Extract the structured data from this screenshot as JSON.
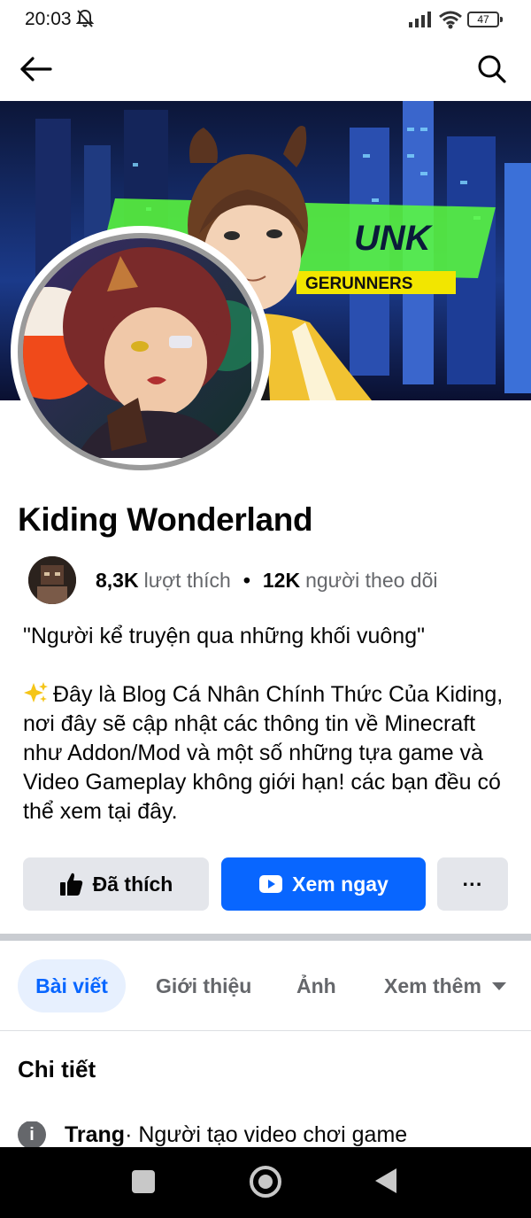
{
  "status_bar": {
    "time": "20:03",
    "battery": "47",
    "icons": [
      "bell-off-icon",
      "signal-icon",
      "wifi-icon",
      "battery-icon"
    ]
  },
  "nav": {
    "icons": [
      "back-arrow-icon",
      "search-icon"
    ]
  },
  "cover": {
    "visible_text": [
      "UNK",
      "GERUNNERS"
    ]
  },
  "page": {
    "name": "Kiding Wonderland",
    "likes_count": "8,3K",
    "likes_label": "lượt thích",
    "followers_count": "12K",
    "followers_label": "người theo dõi"
  },
  "bio": {
    "tagline": "\"Người kể truyện qua những khối vuông\"",
    "description": "Đây là Blog Cá Nhân Chính Thức Của Kiding, nơi đây sẽ cập nhật các thông tin về Minecraft như Addon/Mod và một số những tựa game và Video Gameplay không giới hạn! các bạn đều có thể xem tại đây."
  },
  "actions": {
    "liked_label": "Đã thích",
    "watch_label": "Xem ngay",
    "more_label": "···"
  },
  "tabs": [
    {
      "label": "Bài viết",
      "active": true
    },
    {
      "label": "Giới thiệu",
      "active": false
    },
    {
      "label": "Ảnh",
      "active": false
    },
    {
      "label": "Xem thêm",
      "active": false
    }
  ],
  "details": {
    "title": "Chi tiết",
    "info_icon": "i",
    "row_label": "Trang",
    "row_value": " · Người tạo video chơi game"
  },
  "colors": {
    "accent": "#0866ff",
    "accent_light": "#e7f0fe",
    "secondary_button": "#e4e6eb",
    "muted_text": "#65676b"
  }
}
